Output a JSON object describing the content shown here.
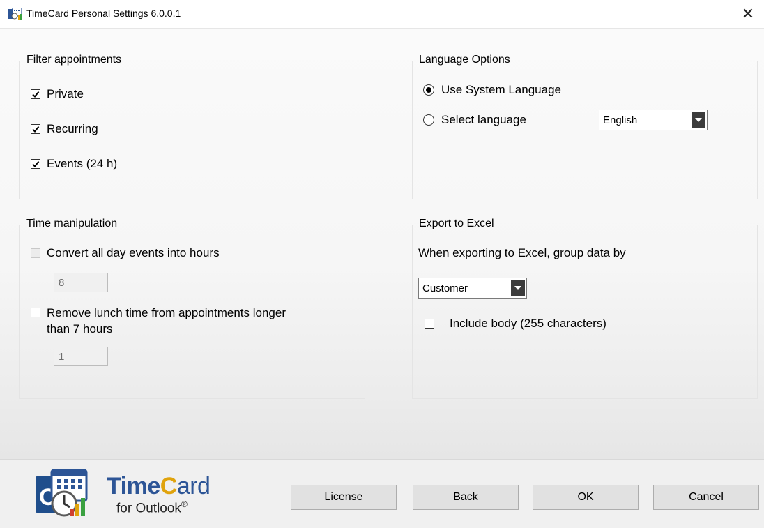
{
  "window": {
    "title": "TimeCard Personal Settings 6.0.0.1",
    "close_label": "✕"
  },
  "filter": {
    "title": "Filter appointments",
    "items": [
      {
        "label": "Private",
        "checked": true
      },
      {
        "label": "Recurring",
        "checked": true
      },
      {
        "label": "Events (24 h)",
        "checked": true
      }
    ]
  },
  "language": {
    "title": "Language Options",
    "use_system": {
      "label": "Use System Language",
      "selected": true
    },
    "select": {
      "label": "Select language",
      "selected": false
    },
    "dropdown_value": "English"
  },
  "time": {
    "title": "Time manipulation",
    "convert": {
      "label": "Convert all day events into hours",
      "checked": false,
      "enabled": false
    },
    "convert_value": "8",
    "lunch": {
      "label_line1": "Remove lunch time from appointments longer",
      "label_line2": "than 7 hours",
      "checked": false
    },
    "lunch_value": "1"
  },
  "export": {
    "title": "Export to Excel",
    "description": "When exporting to Excel, group data by",
    "group_by": "Customer",
    "include_body": {
      "label": "Include body (255 characters)",
      "checked": false
    }
  },
  "brand": {
    "time": "Time",
    "c": "C",
    "ard": "ard",
    "sub": "for Outlook",
    "reg": "®"
  },
  "buttons": {
    "license": "License",
    "back": "Back",
    "ok": "OK",
    "cancel": "Cancel"
  },
  "colors": {
    "brand_blue": "#2d5596",
    "brand_orange": "#e0a30c"
  }
}
